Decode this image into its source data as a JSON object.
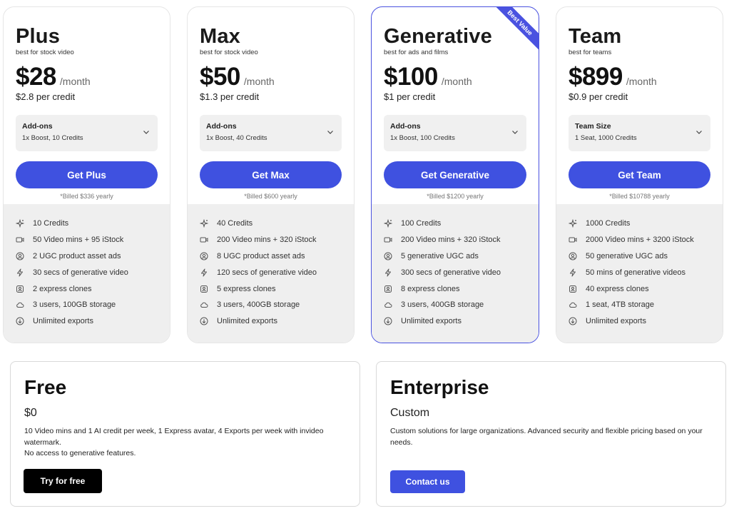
{
  "plans": [
    {
      "name": "Plus",
      "tagline": "best for stock video",
      "price": "$28",
      "per": "/month",
      "per_credit": "$2.8 per credit",
      "addon_title": "Add-ons",
      "addon_value": "1x Boost, 10 Credits",
      "cta": "Get Plus",
      "billed": "*Billed $336 yearly",
      "features": [
        "10 Credits",
        "50 Video mins + 95 iStock",
        "2 UGC product asset ads",
        "30 secs of generative video",
        "2 express clones",
        "3 users, 100GB storage",
        "Unlimited exports"
      ]
    },
    {
      "name": "Max",
      "tagline": "best for stock video",
      "price": "$50",
      "per": "/month",
      "per_credit": "$1.3 per credit",
      "addon_title": "Add-ons",
      "addon_value": "1x Boost, 40 Credits",
      "cta": "Get Max",
      "billed": "*Billed $600 yearly",
      "features": [
        "40 Credits",
        "200 Video mins + 320 iStock",
        "8 UGC product asset ads",
        "120 secs of generative video",
        "5 express clones",
        "3 users, 400GB storage",
        "Unlimited exports"
      ]
    },
    {
      "name": "Generative",
      "tagline": "best for ads and films",
      "price": "$100",
      "per": "/month",
      "per_credit": "$1 per credit",
      "addon_title": "Add-ons",
      "addon_value": "1x Boost, 100 Credits",
      "cta": "Get Generative",
      "billed": "*Billed $1200 yearly",
      "badge": "Best Value",
      "features": [
        "100 Credits",
        "200 Video mins + 320 iStock",
        "5 generative UGC ads",
        "300 secs of generative video",
        "8 express clones",
        "3 users, 400GB storage",
        "Unlimited exports"
      ]
    },
    {
      "name": "Team",
      "tagline": "best for teams",
      "price": "$899",
      "per": "/month",
      "per_credit": "$0.9 per credit",
      "addon_title": "Team Size",
      "addon_value": "1 Seat, 1000 Credits",
      "cta": "Get Team",
      "billed": "*Billed $10788 yearly",
      "features": [
        "1000 Credits",
        "2000 Video mins + 3200 iStock",
        "50 generative UGC ads",
        "50 mins of generative videos",
        "40 express clones",
        "1 seat, 4TB storage",
        "Unlimited exports"
      ]
    }
  ],
  "feature_icons": [
    "sparkle-icon",
    "video-icon",
    "user-circle-icon",
    "lightning-icon",
    "clone-icon",
    "cloud-icon",
    "download-icon"
  ],
  "free": {
    "title": "Free",
    "price": "$0",
    "desc_line1": "10 Video mins and 1 AI credit per week, 1 Express avatar, 4 Exports per week with invideo watermark.",
    "desc_line2": "No access to generative features.",
    "cta": "Try for free"
  },
  "enterprise": {
    "title": "Enterprise",
    "price": "Custom",
    "desc": "Custom solutions for large organizations. Advanced security and flexible pricing based on your needs.",
    "cta": "Contact us"
  },
  "colors": {
    "accent": "#3f51e0",
    "feature_bg": "#efefef",
    "addon_bg": "#f0f0f0"
  }
}
